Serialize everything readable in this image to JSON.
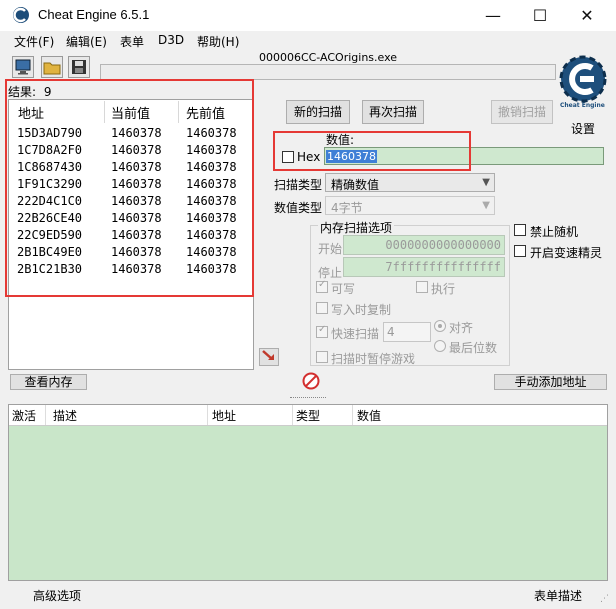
{
  "window": {
    "title": "Cheat Engine 6.5.1",
    "minimize": "—",
    "maximize": "☐",
    "close": "✕"
  },
  "menu": [
    "文件(F)",
    "编辑(E)",
    "表单",
    "D3D",
    "帮助(H)"
  ],
  "toolbar": {
    "process_name": "000006CC-ACOrigins.exe",
    "settings_label": "设置",
    "logo_caption": "Cheat Engine"
  },
  "results": {
    "label": "结果:",
    "count": "9",
    "columns": [
      "地址",
      "当前值",
      "先前值"
    ],
    "rows": [
      [
        "15D3AD790",
        "1460378",
        "1460378"
      ],
      [
        "1C7D8A2F0",
        "1460378",
        "1460378"
      ],
      [
        "1C8687430",
        "1460378",
        "1460378"
      ],
      [
        "1F91C3290",
        "1460378",
        "1460378"
      ],
      [
        "222D4C1C0",
        "1460378",
        "1460378"
      ],
      [
        "22B26CE40",
        "1460378",
        "1460378"
      ],
      [
        "22C9ED590",
        "1460378",
        "1460378"
      ],
      [
        "2B1BC49E0",
        "1460378",
        "1460378"
      ],
      [
        "2B1C21B30",
        "1460378",
        "1460378"
      ]
    ]
  },
  "scan": {
    "new_scan": "新的扫描",
    "next_scan": "再次扫描",
    "undo_scan": "撤销扫描",
    "value_label": "数值:",
    "hex_label": "Hex",
    "value": "1460378",
    "scan_type_label": "扫描类型",
    "scan_type_value": "精确数值",
    "value_type_label": "数值类型",
    "value_type_value": "4字节",
    "memory_options_title": "内存扫描选项",
    "start_label": "开始",
    "start_value": "0000000000000000",
    "stop_label": "停止",
    "stop_value": "7fffffffffffffff",
    "writable_label": "可写",
    "executable_label": "执行",
    "copy_on_write_label": "写入时复制",
    "fast_scan_label": "快速扫描",
    "fast_scan_value": "4",
    "alignment_label": "对齐",
    "last_digits_label": "最后位数",
    "pause_label": "扫描时暂停游戏",
    "disable_random_label": "禁止随机",
    "speedhack_label": "开启变速精灵"
  },
  "bottom_buttons": {
    "view_memory": "查看内存",
    "add_address": "手动添加地址"
  },
  "address_table": {
    "columns": [
      "激活",
      "描述",
      "地址",
      "类型",
      "数值"
    ]
  },
  "status_bar": {
    "advanced_options": "高级选项",
    "table_extras": "表单描述"
  },
  "colors": {
    "highlight_red": "#e53935",
    "table_green": "#c9e6c9",
    "value_green": "#cfe8cf"
  }
}
